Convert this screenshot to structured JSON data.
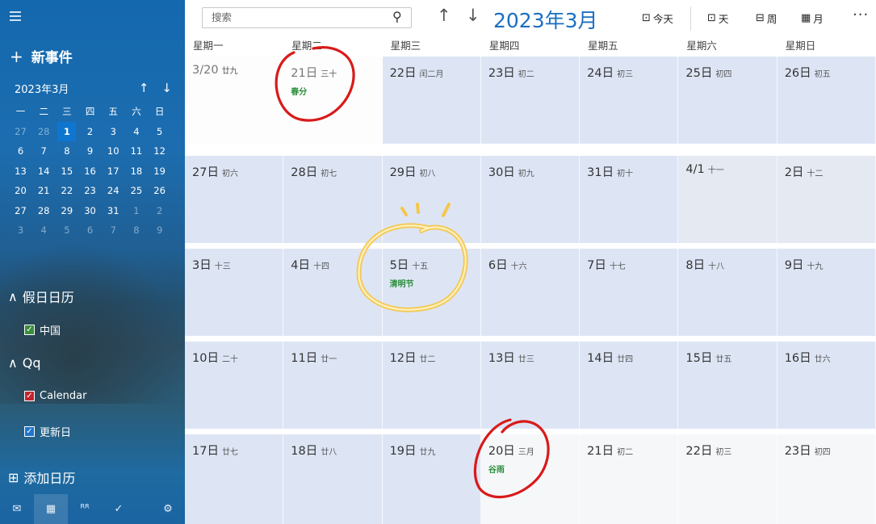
{
  "sidebar": {
    "new_event": "新事件",
    "mini_month": "2023年3月",
    "weekday_heads": [
      "一",
      "二",
      "三",
      "四",
      "五",
      "六",
      "日"
    ],
    "mini_rows": [
      [
        "27",
        "28",
        "1",
        "2",
        "3",
        "4",
        "5"
      ],
      [
        "6",
        "7",
        "8",
        "9",
        "10",
        "11",
        "12"
      ],
      [
        "13",
        "14",
        "15",
        "16",
        "17",
        "18",
        "19"
      ],
      [
        "20",
        "21",
        "22",
        "23",
        "24",
        "25",
        "26"
      ],
      [
        "27",
        "28",
        "29",
        "30",
        "31",
        "1",
        "2"
      ],
      [
        "3",
        "4",
        "5",
        "6",
        "7",
        "8",
        "9"
      ]
    ],
    "holiday_section": "假日日历",
    "holiday_items": [
      "中国"
    ],
    "account_section": "Qq",
    "account_items": [
      "Calendar",
      "更新日"
    ],
    "add_calendar": "添加日历"
  },
  "toolbar": {
    "search_placeholder": "搜索",
    "month_title": "2023年3月",
    "today": "今天",
    "day": "天",
    "week": "周",
    "month": "月",
    "more": "···"
  },
  "weekdays": [
    "星期一",
    "星期二",
    "星期三",
    "星期四",
    "星期五",
    "星期六",
    "星期日"
  ],
  "weeks": [
    [
      {
        "date": "3/20",
        "lunar": "廿九",
        "event": ""
      },
      {
        "date": "21日",
        "lunar": "三十",
        "event": "春分"
      },
      {
        "date": "22日",
        "lunar": "闰二月",
        "event": ""
      },
      {
        "date": "23日",
        "lunar": "初二",
        "event": ""
      },
      {
        "date": "24日",
        "lunar": "初三",
        "event": ""
      },
      {
        "date": "25日",
        "lunar": "初四",
        "event": ""
      },
      {
        "date": "26日",
        "lunar": "初五",
        "event": ""
      }
    ],
    [
      {
        "date": "27日",
        "lunar": "初六",
        "event": ""
      },
      {
        "date": "28日",
        "lunar": "初七",
        "event": ""
      },
      {
        "date": "29日",
        "lunar": "初八",
        "event": ""
      },
      {
        "date": "30日",
        "lunar": "初九",
        "event": ""
      },
      {
        "date": "31日",
        "lunar": "初十",
        "event": ""
      },
      {
        "date": "4/1",
        "lunar": "十一",
        "event": ""
      },
      {
        "date": "2日",
        "lunar": "十二",
        "event": ""
      }
    ],
    [
      {
        "date": "3日",
        "lunar": "十三",
        "event": ""
      },
      {
        "date": "4日",
        "lunar": "十四",
        "event": ""
      },
      {
        "date": "5日",
        "lunar": "十五",
        "event": "清明节"
      },
      {
        "date": "6日",
        "lunar": "十六",
        "event": ""
      },
      {
        "date": "7日",
        "lunar": "十七",
        "event": ""
      },
      {
        "date": "8日",
        "lunar": "十八",
        "event": ""
      },
      {
        "date": "9日",
        "lunar": "十九",
        "event": ""
      }
    ],
    [
      {
        "date": "10日",
        "lunar": "二十",
        "event": ""
      },
      {
        "date": "11日",
        "lunar": "廿一",
        "event": ""
      },
      {
        "date": "12日",
        "lunar": "廿二",
        "event": ""
      },
      {
        "date": "13日",
        "lunar": "廿三",
        "event": ""
      },
      {
        "date": "14日",
        "lunar": "廿四",
        "event": ""
      },
      {
        "date": "15日",
        "lunar": "廿五",
        "event": ""
      },
      {
        "date": "16日",
        "lunar": "廿六",
        "event": ""
      }
    ],
    [
      {
        "date": "17日",
        "lunar": "廿七",
        "event": ""
      },
      {
        "date": "18日",
        "lunar": "廿八",
        "event": ""
      },
      {
        "date": "19日",
        "lunar": "廿九",
        "event": ""
      },
      {
        "date": "20日",
        "lunar": "三月",
        "event": "谷雨"
      },
      {
        "date": "21日",
        "lunar": "初二",
        "event": ""
      },
      {
        "date": "22日",
        "lunar": "初三",
        "event": ""
      },
      {
        "date": "23日",
        "lunar": "初四",
        "event": ""
      }
    ]
  ]
}
